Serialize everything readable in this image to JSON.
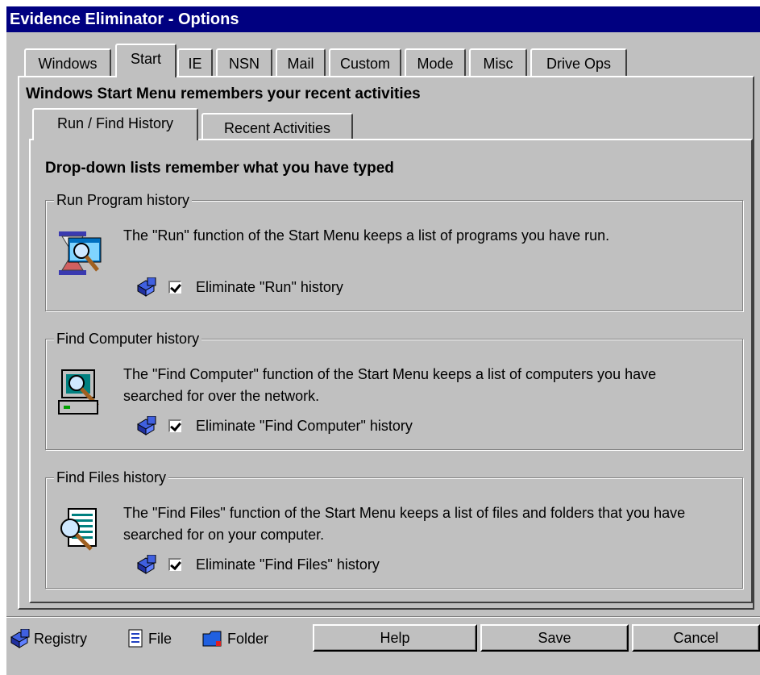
{
  "window": {
    "title": "Evidence Eliminator - Options"
  },
  "tabs": [
    "Windows",
    "Start",
    "IE",
    "NSN",
    "Mail",
    "Custom",
    "Mode",
    "Misc",
    "Drive Ops"
  ],
  "active_tab": "Start",
  "page_heading": "Windows Start Menu remembers your recent activities",
  "subtabs": [
    "Run / Find History",
    "Recent Activities"
  ],
  "active_subtab": "Run / Find History",
  "sub_heading": "Drop-down lists remember what you have typed",
  "groups": [
    {
      "legend": "Run Program history",
      "description": "The \"Run\" function of the Start Menu keeps a list of programs you have run.",
      "checkbox_label": "Eliminate \"Run\" history",
      "checked": true,
      "icon": "run-hourglass-icon"
    },
    {
      "legend": "Find Computer history",
      "description": "The \"Find Computer\" function of the Start Menu keeps a list of computers you have searched for over the network.",
      "checkbox_label": "Eliminate \"Find Computer\" history",
      "checked": true,
      "icon": "find-computer-icon"
    },
    {
      "legend": "Find Files history",
      "description": "The \"Find Files\" function of the Start Menu keeps a list of files and folders that you have searched for on your computer.",
      "checkbox_label": "Eliminate \"Find Files\" history",
      "checked": true,
      "icon": "find-files-icon"
    }
  ],
  "bottom": {
    "registry": "Registry",
    "file": "File",
    "folder": "Folder",
    "help": "Help",
    "save": "Save",
    "cancel": "Cancel"
  },
  "colors": {
    "titlebar": "#000080",
    "face": "#c0c0c0",
    "shadow": "#808080",
    "highlight": "#ffffff"
  }
}
